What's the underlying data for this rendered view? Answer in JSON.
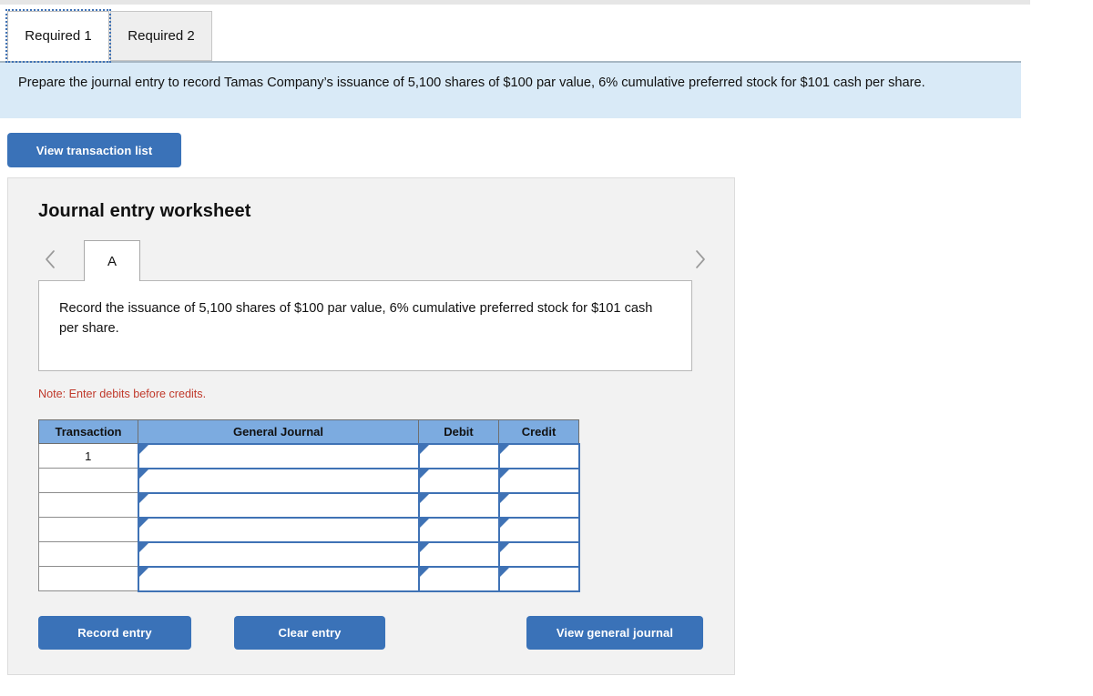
{
  "tabs": [
    {
      "label": "Required 1",
      "active": true
    },
    {
      "label": "Required 2",
      "active": false
    }
  ],
  "instruction_banner": {
    "text": "Prepare the journal entry to record Tamas Company’s issuance of 5,100 shares of $100 par value, 6% cumulative preferred stock for $101 cash per share."
  },
  "toolbar": {
    "view_transaction_list_label": "View transaction list"
  },
  "worksheet": {
    "title": "Journal entry worksheet",
    "prev_icon": "chevron-left-icon",
    "next_icon": "chevron-right-icon",
    "page_tabs": [
      {
        "label": "A",
        "active": true
      }
    ],
    "record_instruction": "Record the issuance of 5,100 shares of $100 par value, 6% cumulative preferred stock for $101 cash per share.",
    "note": "Note: Enter debits before credits.",
    "table": {
      "headers": [
        "Transaction",
        "General Journal",
        "Debit",
        "Credit"
      ],
      "rows": [
        {
          "transaction": "1",
          "general_journal": "",
          "debit": "",
          "credit": ""
        },
        {
          "transaction": "",
          "general_journal": "",
          "debit": "",
          "credit": ""
        },
        {
          "transaction": "",
          "general_journal": "",
          "debit": "",
          "credit": ""
        },
        {
          "transaction": "",
          "general_journal": "",
          "debit": "",
          "credit": ""
        },
        {
          "transaction": "",
          "general_journal": "",
          "debit": "",
          "credit": ""
        },
        {
          "transaction": "",
          "general_journal": "",
          "debit": "",
          "credit": ""
        }
      ]
    },
    "actions": {
      "record_label": "Record entry",
      "clear_label": "Clear entry",
      "view_general_journal_label": "View general journal"
    }
  },
  "colors": {
    "accent_blue": "#3a72b8",
    "header_blue": "#7cabe0",
    "banner_blue": "#d9eaf7",
    "note_red": "#c0392b",
    "panel_gray": "#f2f2f2"
  }
}
